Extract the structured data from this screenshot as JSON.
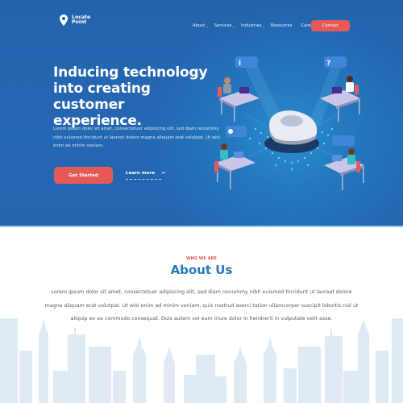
{
  "brand": {
    "name_line1": "Locate",
    "name_line2": "Point",
    "logo_icon": "map-pin-icon"
  },
  "nav": {
    "items": [
      {
        "label": "About",
        "has_dropdown": true
      },
      {
        "label": "Services",
        "has_dropdown": true
      },
      {
        "label": "Industries",
        "has_dropdown": true
      },
      {
        "label": "Resources",
        "has_dropdown": false
      },
      {
        "label": "Careers",
        "has_dropdown": false
      }
    ],
    "dropdown_glyph": "⌄",
    "contact_label": "Contact"
  },
  "hero": {
    "title": "Inducing technology into creating customer experience.",
    "description": "Lorem ipsum dolor sit amet, consectetuer adipiscing elit, sed diam nonummy nibh euismod tincidunt ut laoreet dolore magna aliquam erat volutpat. Ut wisi enim ad minim veniam.",
    "primary_button": "Get Started",
    "secondary_link": "Learn more",
    "secondary_arrow": "→",
    "illustration": "isometric customer support agents around central location pin"
  },
  "about": {
    "eyebrow": "WHO WE ARE",
    "title": "About Us",
    "text": "Lorem ipsum dolor sit amet, consectetuer adipiscing elit, sed diam nonummy nibh euismod tincidunt ut laoreet dolore magna aliquam erat volutpat. Ut wisi enim ad minim veniam, quis nostrud exerci tation ullamcorper suscipit lobortis nisl ut aliquip ex ea commodo consequat. Duis autem vel eum iriure dolor in hendrerit in vulputate velit esse."
  },
  "colors": {
    "hero_bg": "#2363ae",
    "accent": "#e55a57",
    "heading_blue": "#2a78be",
    "skyline": "#dfeaf5"
  }
}
